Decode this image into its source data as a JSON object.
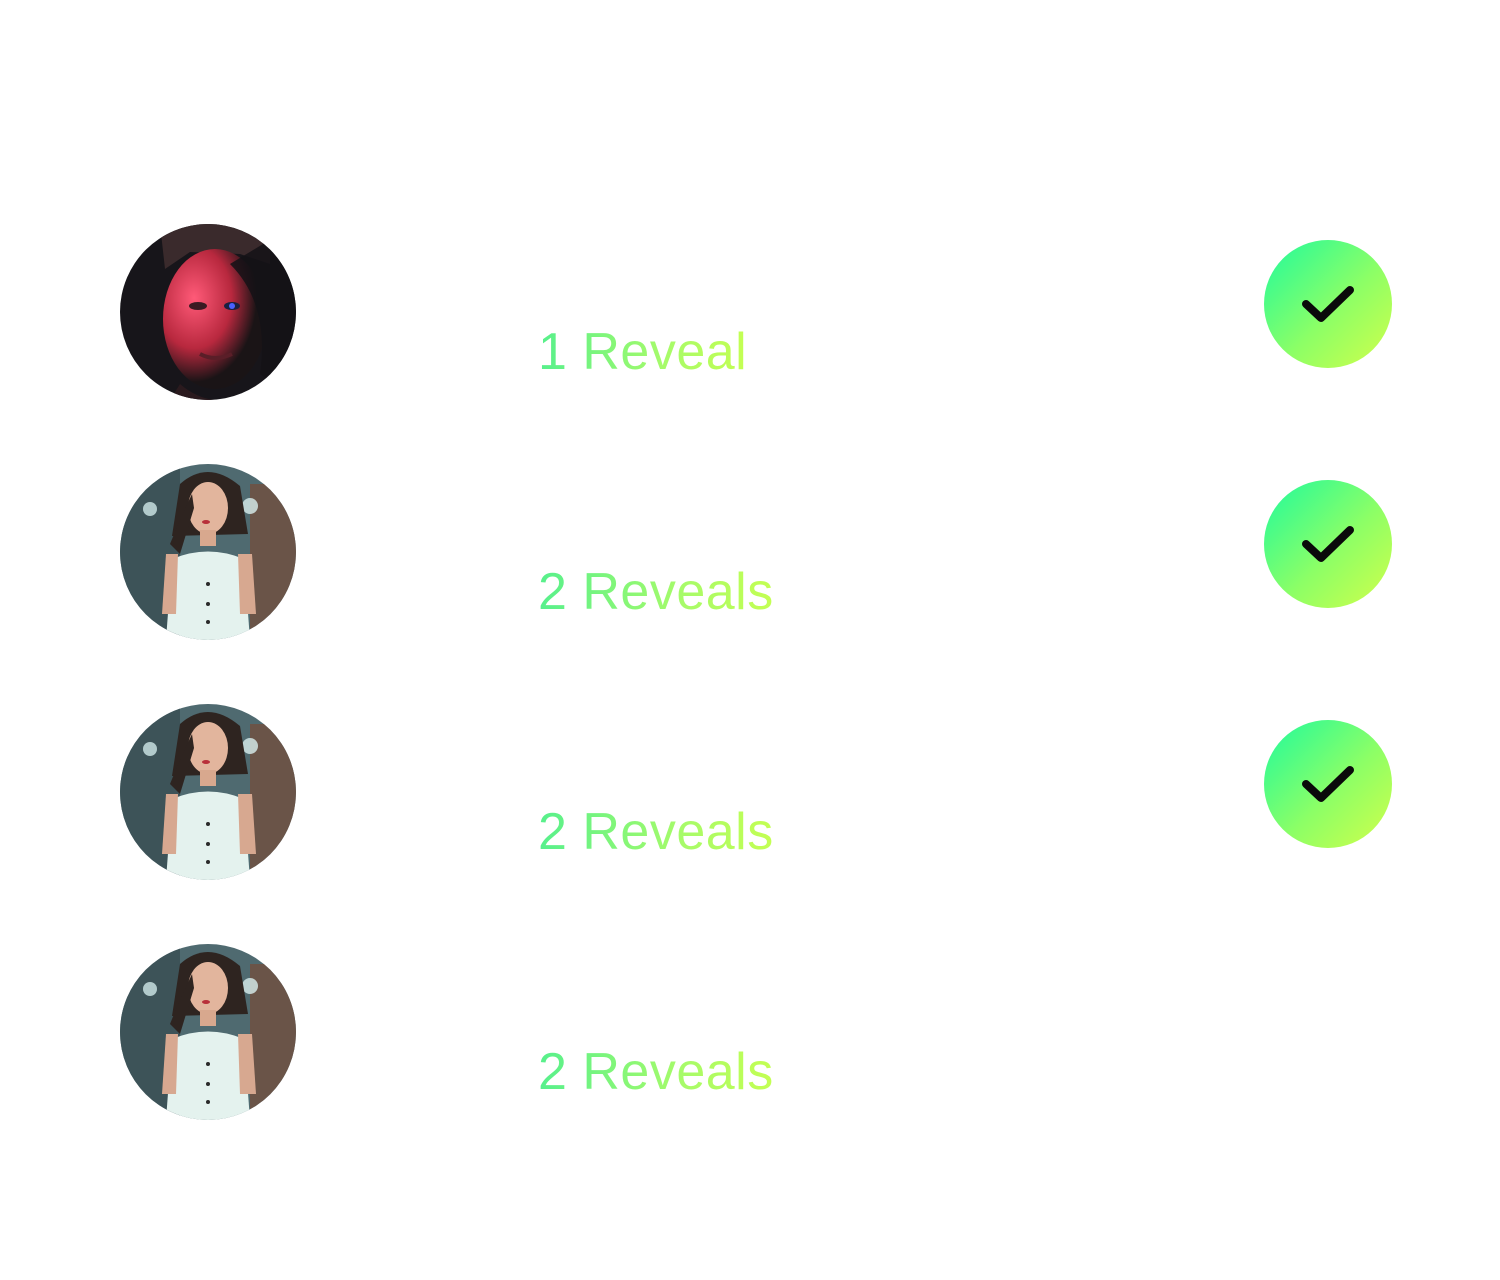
{
  "theme": {
    "background": "#ffffff",
    "label_gradient": [
      "#56f08c",
      "#c4ff52"
    ],
    "check_gradient": [
      "#1efa9e",
      "#d2ff4a"
    ],
    "check_mark_color": "#0a0a0a"
  },
  "rows": [
    {
      "avatar": "man-portrait-red-light",
      "label": "1 Reveal",
      "checked": true
    },
    {
      "avatar": "woman-portrait-white-top",
      "label": "2 Reveals",
      "checked": true
    },
    {
      "avatar": "woman-portrait-white-top",
      "label": "2 Reveals",
      "checked": true
    },
    {
      "avatar": "woman-portrait-white-top",
      "label": "2 Reveals",
      "checked": false
    }
  ],
  "icons": {
    "check": "check-icon"
  }
}
